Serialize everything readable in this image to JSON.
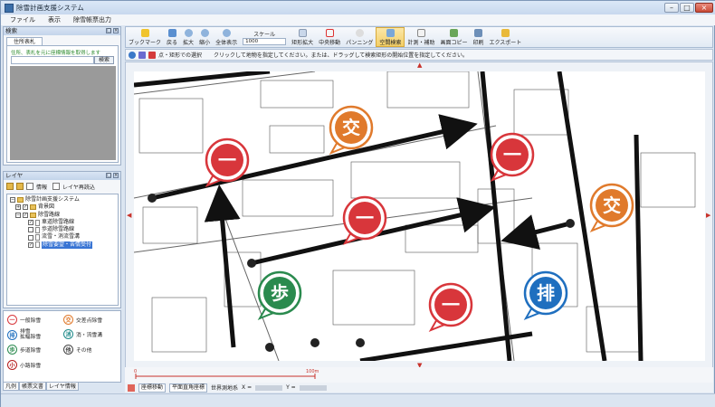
{
  "window": {
    "title": "除雪計画支援システム"
  },
  "menu": [
    "ファイル",
    "表示",
    "除雪帳票出力"
  ],
  "search_panel": {
    "title": "検索",
    "tab": "住所表札",
    "hint": "住所、表札を元に座標情報を取得します",
    "button": "検索"
  },
  "layer_panel": {
    "title": "レイヤ",
    "info_label": "情報",
    "reload_label": "レイヤ再読込",
    "tree": [
      {
        "label": "除雪計画支援システム",
        "level": 0,
        "checked": null,
        "kind": "root"
      },
      {
        "label": "背景図",
        "level": 1,
        "checked": true,
        "kind": "folder"
      },
      {
        "label": "除雪路線",
        "level": 1,
        "checked": true,
        "kind": "folder"
      },
      {
        "label": "車道除雪路線",
        "level": 2,
        "checked": true,
        "kind": "doc"
      },
      {
        "label": "歩道除雪路線",
        "level": 2,
        "checked": false,
        "kind": "doc"
      },
      {
        "label": "流雪・消流雪溝",
        "level": 2,
        "checked": false,
        "kind": "doc"
      },
      {
        "label": "除雪要望・苦情受付",
        "level": 2,
        "checked": true,
        "kind": "doc",
        "selected": true
      }
    ]
  },
  "legend": {
    "items": [
      {
        "glyph": "一",
        "label": "一般除雪",
        "color": "#d8363b"
      },
      {
        "glyph": "交",
        "label": "交差点除雪",
        "color": "#e07a2c"
      },
      {
        "glyph": "排",
        "label": "排雪\n拡幅除雪",
        "color": "#1f6fbf"
      },
      {
        "glyph": "消",
        "label": "消・流雪溝",
        "color": "#1f8a8a"
      },
      {
        "glyph": "歩",
        "label": "歩道除雪",
        "color": "#2a8a4e"
      },
      {
        "glyph": "他",
        "label": "その他",
        "color": "#444444"
      },
      {
        "glyph": "小",
        "label": "小路除雪",
        "color": "#b51c1c"
      }
    ],
    "tabs": [
      "凡例",
      "帳票文書",
      "レイヤ情報"
    ]
  },
  "toolbar": {
    "buttons": [
      {
        "label": "ブックマーク",
        "icon": "star-icon"
      },
      {
        "label": "戻る",
        "icon": "back-icon"
      },
      {
        "label": "拡大",
        "icon": "zoom-in-icon"
      },
      {
        "label": "縮小",
        "icon": "zoom-out-icon"
      },
      {
        "label": "全体表示",
        "icon": "full-extent-icon"
      }
    ],
    "scale_label": "スケール",
    "scale_value": "1000",
    "buttons2": [
      {
        "label": "矩形拡大",
        "icon": "rect-zoom-icon"
      },
      {
        "label": "中央移動",
        "icon": "center-move-icon"
      },
      {
        "label": "パンニング",
        "icon": "pan-icon"
      },
      {
        "label": "空間検索",
        "icon": "spatial-search-icon",
        "active": true
      },
      {
        "label": "計測・補助",
        "icon": "measure-icon"
      },
      {
        "label": "画面コピー",
        "icon": "copy-icon"
      },
      {
        "label": "印刷",
        "icon": "print-icon"
      },
      {
        "label": "エクスポート",
        "icon": "export-icon"
      }
    ]
  },
  "hintbar": {
    "mode": "点・矩形での選択",
    "message": "クリックして地物を指定してください。または、ドラッグして検索矩形の開始位置を指定してください。"
  },
  "map": {
    "markers": [
      {
        "glyph": "一",
        "color": "#d8363b",
        "kind": "一般除雪"
      },
      {
        "glyph": "交",
        "color": "#e07a2c",
        "kind": "交差点除雪"
      },
      {
        "glyph": "一",
        "color": "#d8363b",
        "kind": "一般除雪"
      },
      {
        "glyph": "一",
        "color": "#d8363b",
        "kind": "一般除雪"
      },
      {
        "glyph": "交",
        "color": "#e07a2c",
        "kind": "交差点除雪"
      },
      {
        "glyph": "歩",
        "color": "#2a8a4e",
        "kind": "歩道除雪"
      },
      {
        "glyph": "一",
        "color": "#d8363b",
        "kind": "一般除雪"
      },
      {
        "glyph": "排",
        "color": "#1f6fbf",
        "kind": "排雪"
      }
    ]
  },
  "scalebar": {
    "start": "0",
    "end": "100m"
  },
  "bottombar": {
    "coord_move": "座標移動",
    "coord_system": "平面直角座標",
    "geodetic": "世界測地系",
    "x_label": "X =",
    "y_label": "Y ="
  }
}
